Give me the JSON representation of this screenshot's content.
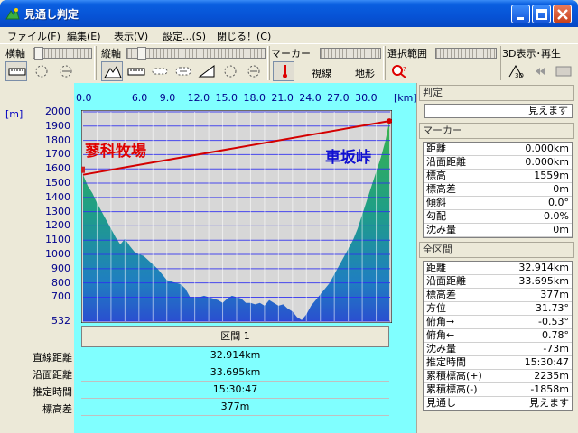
{
  "window": {
    "title": "見通し判定"
  },
  "menu": [
    {
      "label": "ファイル(F)"
    },
    {
      "label": "編集(E)"
    },
    {
      "label": "表示(V)"
    },
    {
      "label": "設定...(S)"
    },
    {
      "label": "閉じる！(C)"
    }
  ],
  "toolbar": {
    "horizontal_axis": "横軸",
    "vertical_axis": "縦軸",
    "marker": "マーカー",
    "selection_range": "選択範囲",
    "view3d": "3D表示･再生",
    "radio_line": "視線",
    "radio_terrain": "地形",
    "radio_selected": "地形"
  },
  "chart": {
    "y_unit": "[m]",
    "x_unit": "[km]",
    "y_ticks": [
      "2000",
      "1900",
      "1800",
      "1700",
      "1600",
      "1500",
      "1400",
      "1300",
      "1200",
      "1100",
      "1000",
      "900",
      "800",
      "700",
      "532"
    ],
    "x_ticks": [
      "0.0",
      "6.0",
      "9.0",
      "12.0",
      "15.0",
      "18.0",
      "21.0",
      "24.0",
      "27.0",
      "30.0"
    ],
    "start_label": "蓼科牧場",
    "end_label": "車坂峠",
    "colors": {
      "sky": "#d7d7d7",
      "grid": "#2f2ff0",
      "line": "#d40000",
      "start_label": "#e00000",
      "end_label": "#1010d0"
    }
  },
  "chart_data": {
    "type": "area",
    "xlabel": "",
    "ylabel": "",
    "x_unit": "km",
    "y_unit": "m",
    "xlim": [
      0,
      33
    ],
    "ylim": [
      532,
      2000
    ],
    "series": [
      {
        "x": [
          0.0,
          0.5,
          1.0,
          1.5,
          2.0,
          2.5,
          3.0,
          3.5,
          4.0,
          4.5,
          5.0,
          5.5,
          6.0,
          6.5,
          7.0,
          7.5,
          8.0,
          8.5,
          9.0,
          9.5,
          10.0,
          10.5,
          11.0,
          11.5,
          12.0,
          12.5,
          13.0,
          13.5,
          14.0,
          14.5,
          15.0,
          15.5,
          16.0,
          16.5,
          17.0,
          17.5,
          18.0,
          18.5,
          19.0,
          19.5,
          20.0,
          20.5,
          21.0,
          21.5,
          22.0,
          22.5,
          23.0,
          23.5,
          24.0,
          24.5,
          25.0,
          25.5,
          26.0,
          26.5,
          27.0,
          27.5,
          28.0,
          28.5,
          29.0,
          29.5,
          30.0,
          30.5,
          31.0,
          31.5,
          32.0,
          32.5,
          32.914
        ],
        "y": [
          1559,
          1480,
          1430,
          1360,
          1300,
          1240,
          1180,
          1120,
          1070,
          1110,
          1060,
          1020,
          1000,
          990,
          960,
          930,
          900,
          860,
          820,
          810,
          800,
          790,
          760,
          700,
          700,
          700,
          710,
          700,
          690,
          680,
          660,
          690,
          710,
          700,
          690,
          660,
          660,
          650,
          660,
          640,
          680,
          660,
          640,
          650,
          620,
          600,
          560,
          540,
          580,
          640,
          680,
          720,
          760,
          800,
          860,
          920,
          980,
          1040,
          1100,
          1180,
          1280,
          1380,
          1480,
          1580,
          1680,
          1800,
          1936
        ]
      }
    ]
  },
  "section": {
    "header": "区間 1",
    "labels": [
      "直線距離",
      "沿面距離",
      "推定時間",
      "標高差"
    ],
    "values": [
      "32.914km",
      "33.695km",
      "15:30:47",
      "377m"
    ]
  },
  "judge": {
    "header": "判定",
    "value": "見えます"
  },
  "marker_panel": {
    "header": "マーカー",
    "rows": [
      {
        "k": "距離",
        "v": "0.000km"
      },
      {
        "k": "沿面距離",
        "v": "0.000km"
      },
      {
        "k": "標高",
        "v": "1559m"
      },
      {
        "k": "標高差",
        "v": "0m"
      },
      {
        "k": "傾斜",
        "v": "0.0°"
      },
      {
        "k": "勾配",
        "v": "0.0%"
      },
      {
        "k": "沈み量",
        "v": "0m"
      }
    ]
  },
  "total_panel": {
    "header": "全区間",
    "rows": [
      {
        "k": "距離",
        "v": "32.914km"
      },
      {
        "k": "沿面距離",
        "v": "33.695km"
      },
      {
        "k": "標高差",
        "v": "377m"
      },
      {
        "k": "方位",
        "v": "31.73°"
      },
      {
        "k": "俯角→",
        "v": "-0.53°"
      },
      {
        "k": "俯角←",
        "v": "0.78°"
      },
      {
        "k": "沈み量",
        "v": "-73m"
      },
      {
        "k": "推定時間",
        "v": "15:30:47"
      },
      {
        "k": "累積標高(+)",
        "v": "2235m"
      },
      {
        "k": "累積標高(-)",
        "v": "-1858m"
      },
      {
        "k": "見通し",
        "v": "見えます"
      }
    ]
  }
}
